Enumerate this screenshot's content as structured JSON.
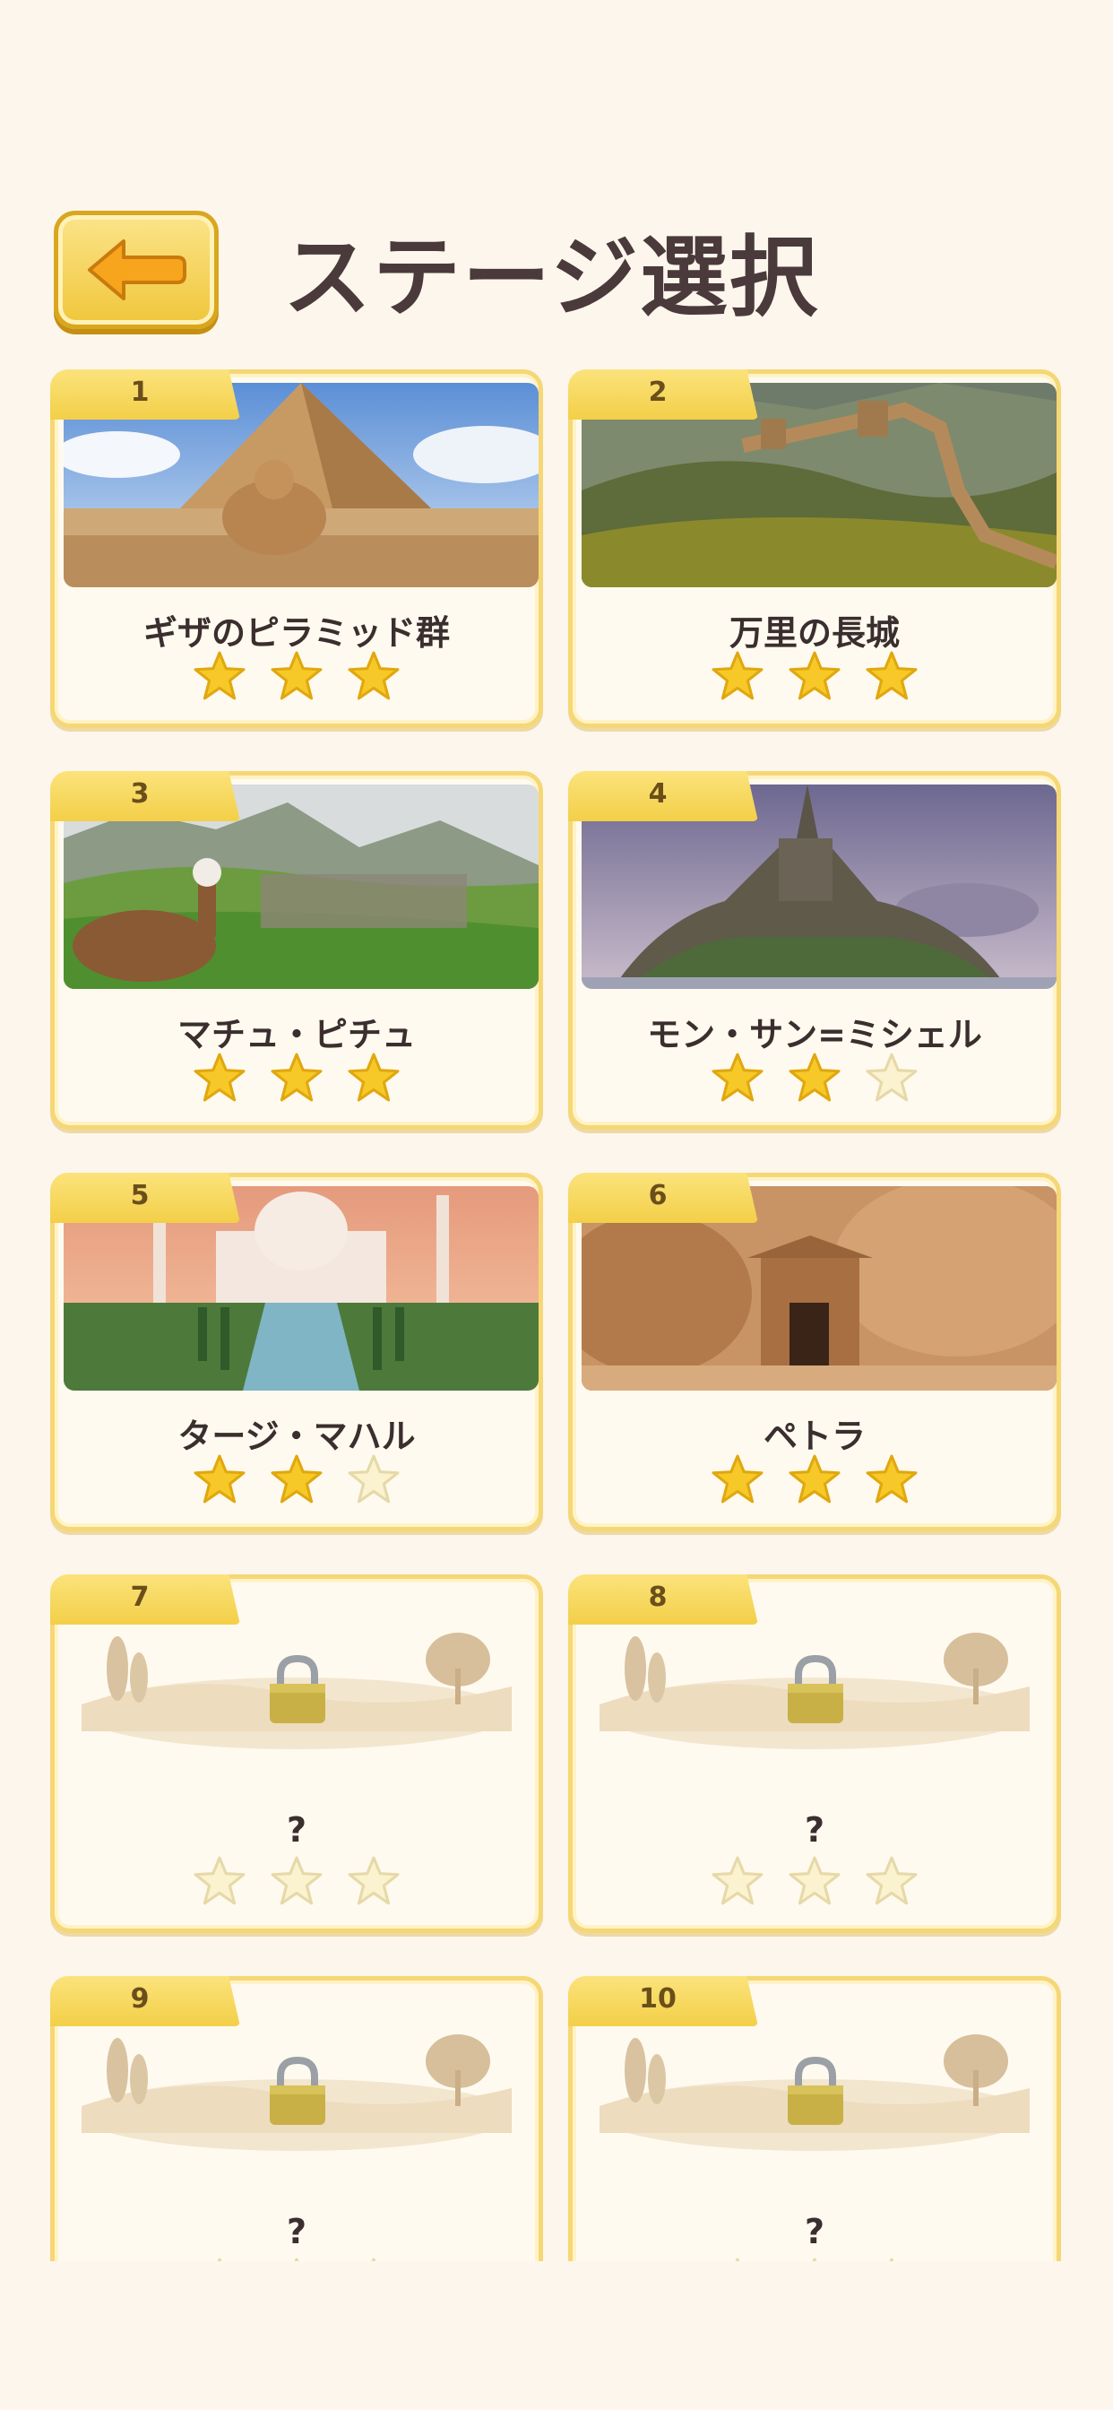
{
  "header": {
    "title": "ステージ選択",
    "back_icon": "arrow-left-icon"
  },
  "colors": {
    "background": "#fdf6ec",
    "card_border": "#f5d776",
    "tab": "#f3cf48",
    "star_filled": "#f7c928",
    "star_empty": "#fbf2cf",
    "title_text": "#4a3a3c"
  },
  "stages": [
    {
      "number": "1",
      "name": "ギザのピラミッド群",
      "stars": 3,
      "locked": false,
      "image": "pyramids"
    },
    {
      "number": "2",
      "name": "万里の長城",
      "stars": 3,
      "locked": false,
      "image": "great-wall"
    },
    {
      "number": "3",
      "name": "マチュ・ピチュ",
      "stars": 3,
      "locked": false,
      "image": "machu-picchu"
    },
    {
      "number": "4",
      "name": "モン・サン=ミシェル",
      "stars": 2,
      "locked": false,
      "image": "mont-saint-michel"
    },
    {
      "number": "5",
      "name": "タージ・マハル",
      "stars": 2,
      "locked": false,
      "image": "taj-mahal"
    },
    {
      "number": "6",
      "name": "ペトラ",
      "stars": 3,
      "locked": false,
      "image": "petra"
    },
    {
      "number": "7",
      "name": "?",
      "stars": 0,
      "locked": true,
      "image": "locked"
    },
    {
      "number": "8",
      "name": "?",
      "stars": 0,
      "locked": true,
      "image": "locked"
    },
    {
      "number": "9",
      "name": "?",
      "stars": 0,
      "locked": true,
      "image": "locked"
    },
    {
      "number": "10",
      "name": "?",
      "stars": 0,
      "locked": true,
      "image": "locked"
    }
  ]
}
